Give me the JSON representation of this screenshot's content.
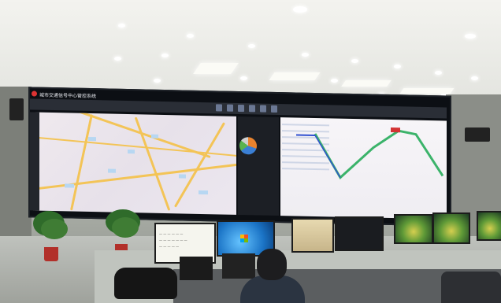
{
  "scene": {
    "description_colors": {
      "wall_bg": "#c6c8c2",
      "map_road": "#f3c457",
      "route_green": "#3bb36a",
      "route_blue": "#2f4fd0",
      "accent_red": "#d33333"
    }
  },
  "videowall": {
    "title": "城市交通信号中心管控系统"
  },
  "monitor_paper": {
    "lines": [
      "一 一 一 一 一 一",
      "一 一 一 一 一 一 一",
      "一 一 一 一 一"
    ]
  },
  "icons": [
    "logo-icon",
    "pie-chart-icon",
    "map-marker-icon",
    "windows-logo-icon"
  ]
}
